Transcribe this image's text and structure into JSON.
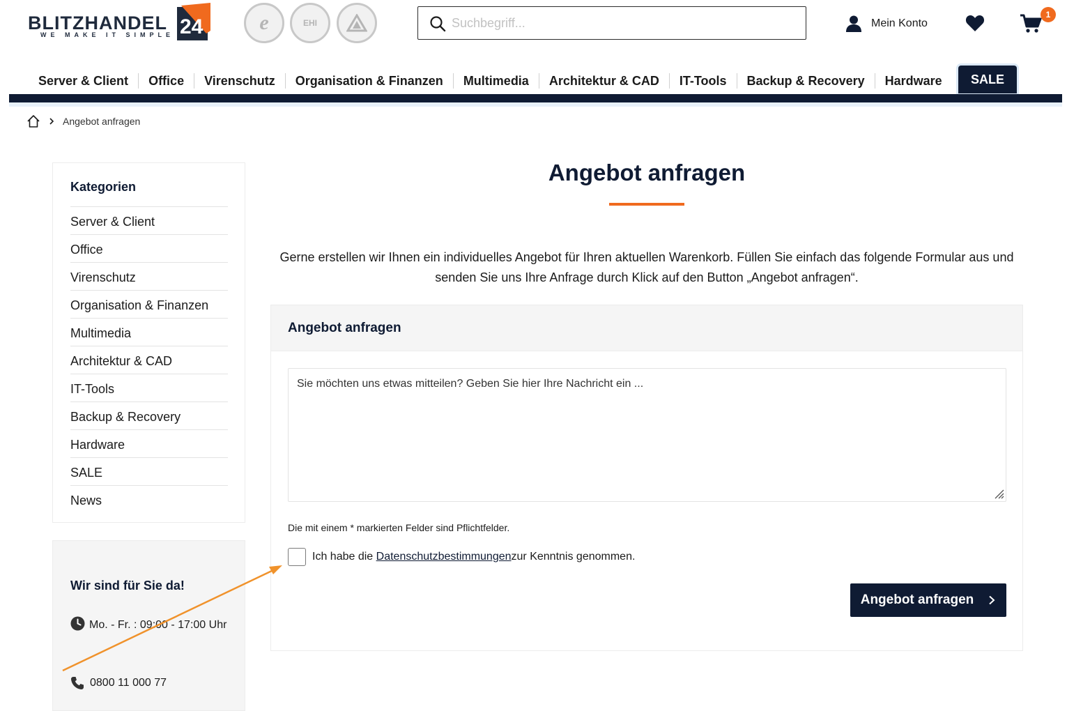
{
  "header": {
    "logo_text": "BLITZHANDEL",
    "logo_number": "24",
    "logo_tagline": "WE MAKE IT SIMPLE",
    "trust_badges": [
      {
        "icon": "trusted-shops-badge-icon",
        "label": "e"
      },
      {
        "icon": "ehi-badge-icon",
        "label": "EHI"
      },
      {
        "icon": "tuv-badge-icon",
        "label": "TÜV"
      }
    ],
    "search_placeholder": "Suchbegriff...",
    "account_label": "Mein Konto",
    "cart_count": "1",
    "accent_color": "#f06a1e",
    "brand_color": "#0f1b33"
  },
  "nav": {
    "items": [
      "Server & Client",
      "Office",
      "Virenschutz",
      "Organisation & Finanzen",
      "Multimedia",
      "Architektur & CAD",
      "IT-Tools",
      "Backup & Recovery",
      "Hardware"
    ],
    "sale_label": "SALE"
  },
  "breadcrumb": {
    "current": "Angebot anfragen"
  },
  "sidebar": {
    "title": "Kategorien",
    "categories": [
      "Server & Client",
      "Office",
      "Virenschutz",
      "Organisation & Finanzen",
      "Multimedia",
      "Architektur & CAD",
      "IT-Tools",
      "Backup & Recovery",
      "Hardware",
      "SALE",
      "News"
    ]
  },
  "contact": {
    "title": "Wir sind für Sie da!",
    "hours": "Mo. - Fr. : 09:00 - 17:00 Uhr",
    "phone": "0800 11 000 77"
  },
  "main": {
    "title": "Angebot anfragen",
    "intro": "Gerne erstellen wir Ihnen ein individuelles Angebot für Ihren aktuellen Warenkorb. Füllen Sie einfach das folgende Formular aus und senden Sie uns Ihre Anfrage durch Klick auf den Button „Angebot anfragen“.",
    "form": {
      "heading": "Angebot anfragen",
      "message_placeholder": "Sie möchten uns etwas mitteilen? Geben Sie hier Ihre Nachricht ein ...",
      "required_note": "Die mit einem * markierten Felder sind Pflichtfelder.",
      "consent_before": "Ich habe die ",
      "consent_link": "Datenschutzbestimmungen",
      "consent_after": " zur Kenntnis genommen.",
      "submit_label": "Angebot anfragen"
    }
  }
}
